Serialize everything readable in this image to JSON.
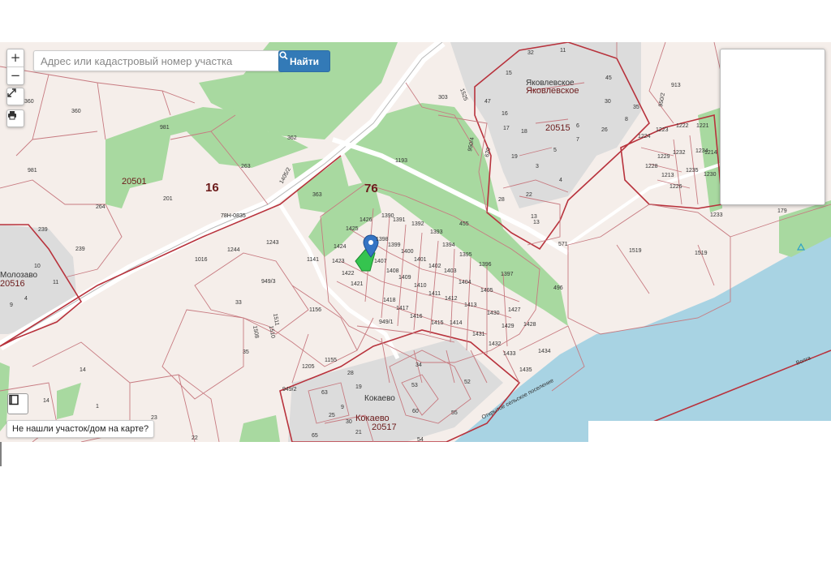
{
  "search": {
    "placeholder": "Адрес или кадастровый номер участка",
    "button_label": "Найти"
  },
  "controls": {
    "zoom_in": "+",
    "zoom_out": "−"
  },
  "not_found_label": "Не нашли участок/дом на карте?",
  "colors": {
    "forest": "#a8d9a0",
    "water": "#a8d3e3",
    "boundary": "#b8323c",
    "parcel": "#c77a80",
    "built": "#dcdcdc",
    "selected": "#35c44f",
    "marker": "#3574c4"
  },
  "map": {
    "quarters": [
      "76",
      "16"
    ],
    "zones": [
      "20501",
      "20515",
      "20517",
      "20516"
    ],
    "settlements": [
      "Яковлевское",
      "Яковлевское",
      "Кокаево",
      "Кокаево",
      "Молозаво"
    ],
    "road_code": "78Н-0835",
    "river": "Волга",
    "boundary_text": "Открытое сельское поселение",
    "parcels": [
      "1390",
      "1391",
      "1392",
      "1393",
      "1394",
      "1395",
      "1396",
      "1397",
      "1398",
      "1399",
      "1400",
      "1401",
      "1402",
      "1403",
      "1404",
      "1405",
      "1407",
      "1408",
      "1409",
      "1410",
      "1411",
      "1412",
      "1413",
      "1414",
      "1415",
      "1416",
      "1417",
      "1418",
      "1421",
      "1422",
      "1423",
      "1424",
      "1425",
      "1426",
      "1427",
      "1428",
      "1429",
      "1430",
      "1431",
      "1432",
      "1433",
      "1434",
      "1435",
      "1193",
      "1156",
      "1155",
      "1205",
      "1243",
      "1244",
      "1016",
      "949/1",
      "949/2",
      "949/3",
      "1141",
      "455",
      "571",
      "1519",
      "1519",
      "496",
      "1224",
      "1223",
      "1222",
      "1221",
      "1228",
      "1229",
      "1232",
      "1234",
      "1213",
      "1226",
      "1235",
      "1230",
      "1233",
      "1214",
      "179",
      "913",
      "363",
      "362",
      "303",
      "981",
      "981",
      "201",
      "264",
      "263",
      "239",
      "239",
      "360",
      "360",
      "1405/2",
      "1525",
      "950/4",
      "950/2",
      "620",
      "28",
      "22",
      "13",
      "35",
      "8",
      "26",
      "30",
      "45",
      "32",
      "11",
      "15",
      "47",
      "16",
      "17",
      "18",
      "19",
      "3",
      "4",
      "5",
      "7",
      "6",
      "33",
      "35",
      "14",
      "14",
      "1",
      "23",
      "22",
      "9",
      "4",
      "10",
      "11",
      "63",
      "28",
      "19",
      "25",
      "30",
      "21",
      "65",
      "34",
      "53",
      "60",
      "52",
      "55",
      "54",
      "1508",
      "1511",
      "1510",
      "13",
      "9"
    ]
  }
}
